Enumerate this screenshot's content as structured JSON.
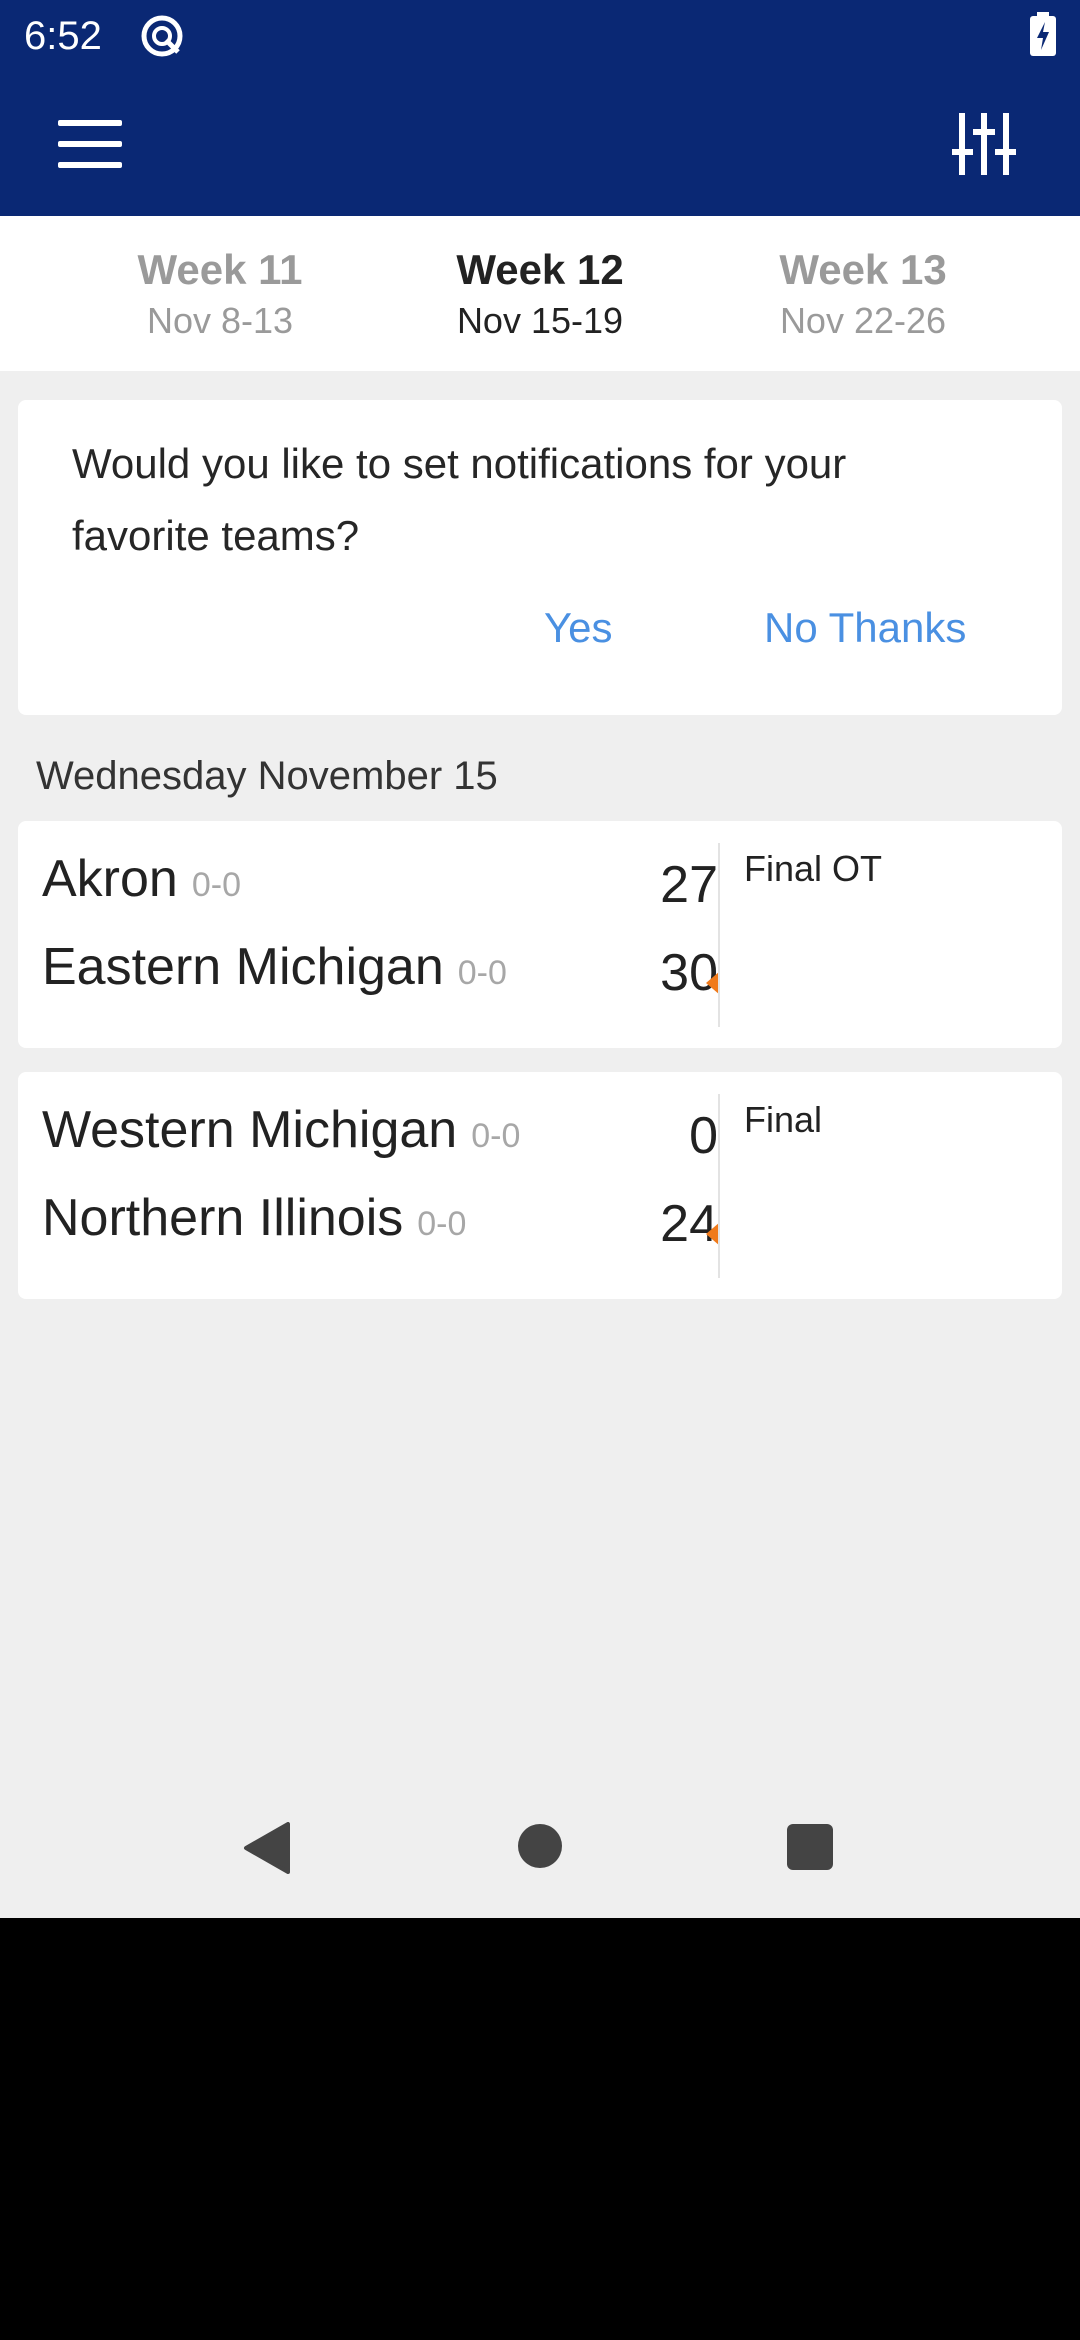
{
  "status_bar": {
    "time": "6:52"
  },
  "colors": {
    "header_bg": "#0a2874",
    "link": "#4a90e2",
    "winner_arrow": "#f07a1a"
  },
  "week_tabs": [
    {
      "week": "Week 11",
      "dates": "Nov 8-13"
    },
    {
      "week": "Week 12",
      "dates": "Nov 15-19"
    },
    {
      "week": "Week 13",
      "dates": "Nov 22-26"
    }
  ],
  "selected_week": "Week 12",
  "notification": {
    "message": "Would you like to set notifications for your favorite teams?",
    "yes_label": "Yes",
    "no_label": "No Thanks"
  },
  "day_header": "Wednesday November 15",
  "games": [
    {
      "status": "Final OT",
      "away": {
        "name": "Akron",
        "record": "0-0",
        "score": "27"
      },
      "home": {
        "name": "Eastern Michigan",
        "record": "0-0",
        "score": "30"
      },
      "winner": "home"
    },
    {
      "status": "Final",
      "away": {
        "name": "Western Michigan",
        "record": "0-0",
        "score": "0"
      },
      "home": {
        "name": "Northern Illinois",
        "record": "0-0",
        "score": "24"
      },
      "winner": "home"
    }
  ],
  "icons": {
    "menu": "hamburger-menu-icon",
    "filter": "sliders-icon",
    "status_app": "app-status-icon",
    "battery": "battery-charging-icon",
    "nav_back": "back-triangle-icon",
    "nav_home": "home-circle-icon",
    "nav_recent": "recents-square-icon"
  }
}
